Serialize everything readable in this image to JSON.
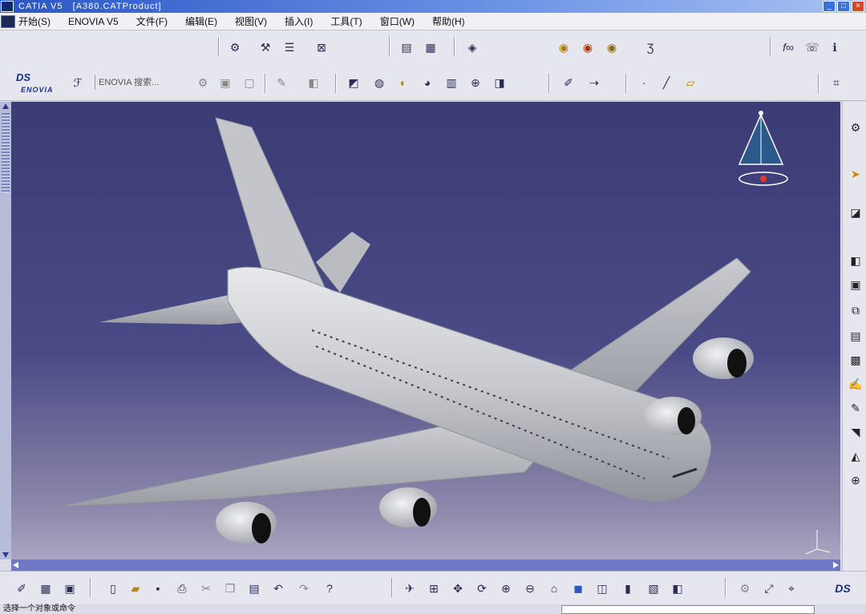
{
  "window": {
    "title": "CATIA V5   [A380.CATProduct]",
    "buttons": [
      "_",
      "□",
      "×"
    ]
  },
  "menu": [
    "开始(S)",
    "ENOVIA V5",
    "文件(F)",
    "编辑(E)",
    "视图(V)",
    "插入(I)",
    "工具(T)",
    "窗口(W)",
    "帮助(H)"
  ],
  "enovia": {
    "logo_text": "ENOVIA",
    "search_label": "ENOVIA 搜索..."
  },
  "status": {
    "message": "选择一个对象或命令"
  },
  "colors": {
    "viewport_top": "#3b3b76",
    "viewport_bottom": "#aaa6c2",
    "aircraft": "#c6c8cc",
    "accent": "#2a56c6"
  },
  "icons": {
    "toolbar_top": [
      "product-icon",
      "constraint-icon",
      "catalog-icon",
      "snap-icon",
      "measure-icon",
      "table-icon",
      "layer-icon",
      "render-icon",
      "material-icon",
      "light-icon",
      "fx-icon",
      "chat-icon"
    ],
    "toolbar_second": [
      "enovia-icon",
      "search-icon",
      "save-enovia-icon",
      "refresh-icon",
      "cube-view-icon",
      "shading-icon",
      "hide-show-icon",
      "swap-icon",
      "grid-icon",
      "normal-view-icon",
      "multi-view-icon",
      "point-icon",
      "line-icon",
      "plane-icon",
      "settings-icon"
    ],
    "toolbar_bottom": [
      "open-icon",
      "new-icon",
      "save-icon",
      "print-icon",
      "cut-icon",
      "copy-icon",
      "paste-icon",
      "undo-icon",
      "redo-icon",
      "help-icon",
      "fit-all-icon",
      "pan-icon",
      "rotate-icon",
      "zoom-in-icon",
      "zoom-out-icon",
      "normal-icon",
      "iso-view-icon",
      "shading-mode-icon",
      "hide-icon",
      "swap-space-icon"
    ],
    "right_toolbar": [
      "gear-icon",
      "select-icon",
      "sketch-icon",
      "assembly-icon",
      "component-icon",
      "constraint-icon",
      "manipulate-icon",
      "snap-icon",
      "explode-icon",
      "clash-icon",
      "measure-icon",
      "section-icon"
    ]
  }
}
